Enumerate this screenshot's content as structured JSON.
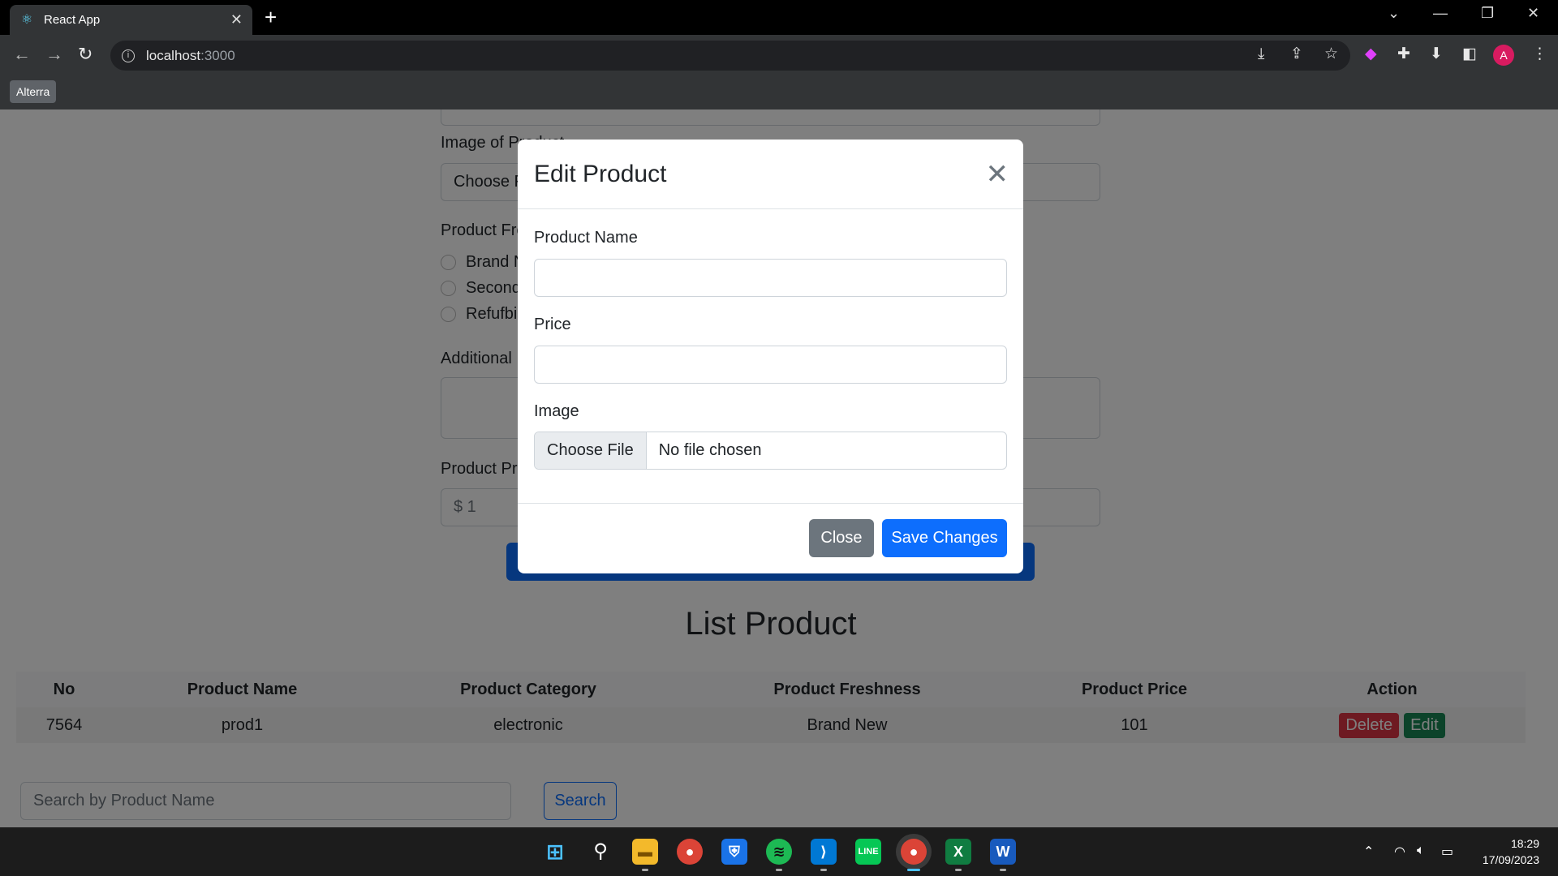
{
  "browser": {
    "tab_title": "React App",
    "url_host": "localhost",
    "url_port": ":3000",
    "bookmark": "Alterra",
    "profile_initial": "A"
  },
  "form": {
    "image_label": "Image of Product",
    "choose_file": "Choose File",
    "freshness_label": "Product Freshness",
    "freshness_options": [
      "Brand New",
      "Second Hand",
      "Refufbished"
    ],
    "additional_label": "Additional Description",
    "price_label": "Product Price",
    "price_value": "$ 1"
  },
  "modal": {
    "title": "Edit Product",
    "close_icon": "close-icon",
    "name_label": "Product Name",
    "name_value": "",
    "price_label": "Price",
    "price_value": "",
    "image_label": "Image",
    "choose_file": "Choose File",
    "no_file": "No file chosen",
    "close_button": "Close",
    "save_button": "Save Changes"
  },
  "list": {
    "title": "List Product",
    "headers": [
      "No",
      "Product Name",
      "Product Category",
      "Product Freshness",
      "Product Price",
      "Action"
    ],
    "rows": [
      {
        "no": "7564",
        "name": "prod1",
        "category": "electronic",
        "freshness": "Brand New",
        "price": "101"
      }
    ],
    "delete_label": "Delete",
    "edit_label": "Edit"
  },
  "search": {
    "placeholder": "Search by Product Name",
    "button": "Search"
  },
  "taskbar": {
    "time": "18:29",
    "date": "17/09/2023"
  }
}
